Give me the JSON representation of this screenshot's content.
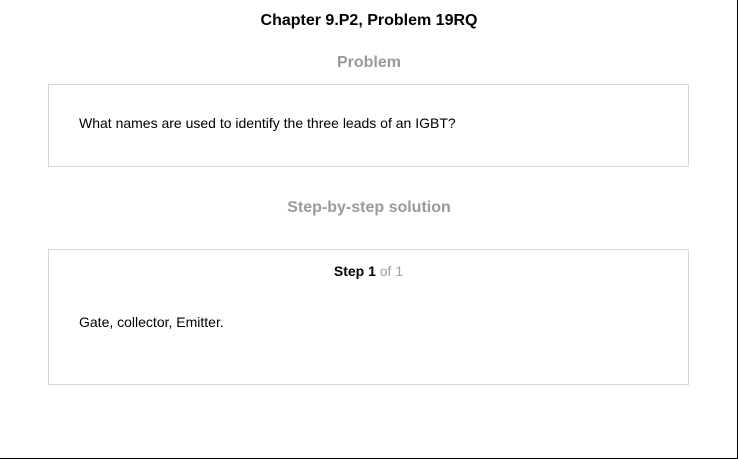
{
  "header": {
    "chapter_title": "Chapter 9.P2, Problem 19RQ"
  },
  "problem": {
    "heading": "Problem",
    "text": "What names are used to identify the three leads of an IGBT?"
  },
  "solution": {
    "heading": "Step-by-step solution",
    "step": {
      "label": "Step 1",
      "count": " of 1"
    },
    "answer": "Gate, collector, Emitter."
  }
}
